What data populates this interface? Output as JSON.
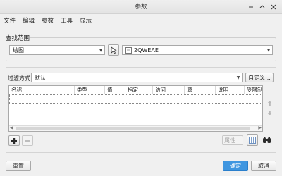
{
  "window": {
    "title": "参数"
  },
  "menu": [
    "文件",
    "编辑",
    "参数",
    "工具",
    "显示"
  ],
  "search_scope": {
    "label": "查找范围",
    "scope_value": "绘图",
    "object_value": "2QWEAE"
  },
  "filter": {
    "label": "过滤方式",
    "value": "默认",
    "custom_button": "自定义..."
  },
  "table": {
    "columns": [
      "名称",
      "类型",
      "值",
      "指定",
      "访问",
      "源",
      "说明",
      "受限制"
    ]
  },
  "toolbar": {
    "properties_button": "属性..."
  },
  "footer": {
    "reset_button": "重置",
    "ok_button": "确定",
    "cancel_button": "取消"
  },
  "colors": {
    "accent": "#3f96e0"
  }
}
